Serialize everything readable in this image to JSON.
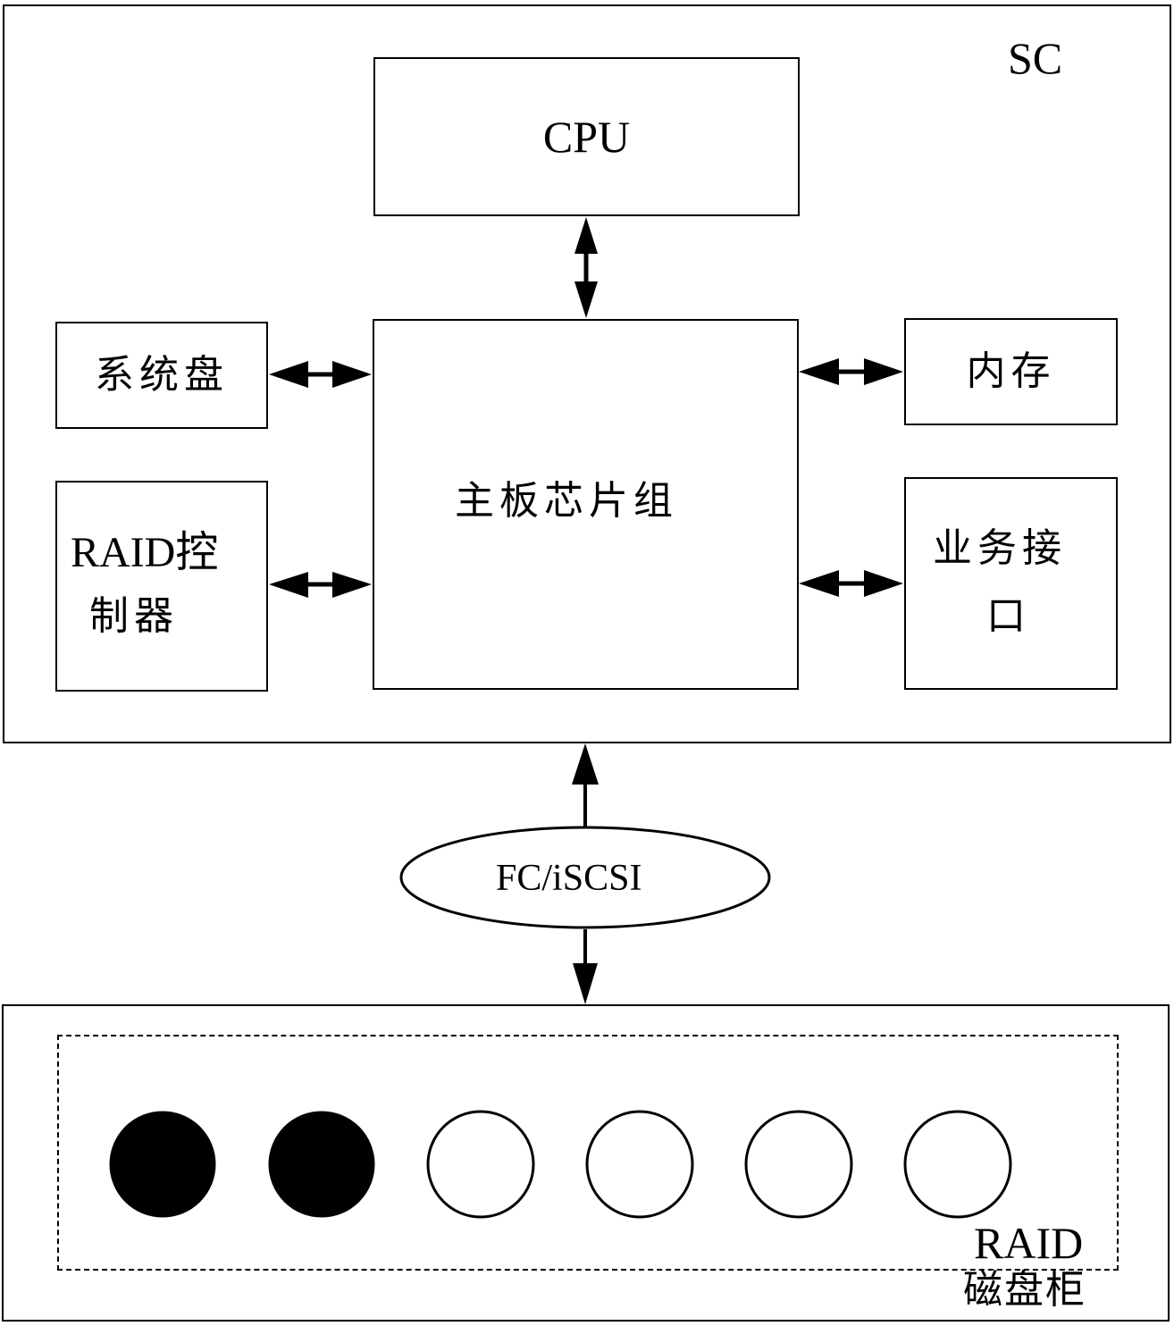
{
  "sc": {
    "title": "SC",
    "cpu": "CPU",
    "chipset": "主板芯片组",
    "system_disk": "系统盘",
    "memory": "内存",
    "raid_controller_line1": "RAID控",
    "raid_controller_line2": "制器",
    "service_interface_line1": "业务接",
    "service_interface_line2": "口"
  },
  "link": {
    "protocol": "FC/iSCSI"
  },
  "raid_cabinet": {
    "label_line1": "RAID",
    "label_line2": "磁盘柜",
    "disks": [
      {
        "state": "filled"
      },
      {
        "state": "filled"
      },
      {
        "state": "empty"
      },
      {
        "state": "empty"
      },
      {
        "state": "empty"
      },
      {
        "state": "empty"
      }
    ]
  }
}
